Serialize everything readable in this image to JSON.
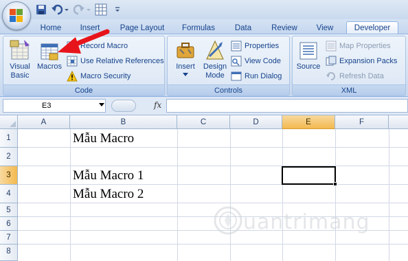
{
  "quick_access": {
    "icons": [
      "office-button",
      "save-icon",
      "undo-icon",
      "redo-icon",
      "form-icon",
      "customize-icon"
    ]
  },
  "tabs": [
    {
      "label": "Home",
      "active": false
    },
    {
      "label": "Insert",
      "active": false
    },
    {
      "label": "Page Layout",
      "active": false
    },
    {
      "label": "Formulas",
      "active": false
    },
    {
      "label": "Data",
      "active": false
    },
    {
      "label": "Review",
      "active": false
    },
    {
      "label": "View",
      "active": false
    },
    {
      "label": "Developer",
      "active": true
    }
  ],
  "ribbon": {
    "code": {
      "label": "Code",
      "visual_basic": "Visual Basic",
      "macros": "Macros",
      "record_macro": "Record Macro",
      "use_relative": "Use Relative References",
      "macro_security": "Macro Security"
    },
    "controls": {
      "label": "Controls",
      "insert": "Insert",
      "design_mode": "Design Mode",
      "properties": "Properties",
      "view_code": "View Code",
      "run_dialog": "Run Dialog"
    },
    "xml": {
      "label": "XML",
      "source": "Source",
      "map_properties": "Map Properties",
      "expansion_packs": "Expansion Packs",
      "refresh_data": "Refresh Data"
    }
  },
  "formula_bar": {
    "name_box": "E3",
    "fx": "fx",
    "formula": ""
  },
  "grid": {
    "columns": [
      "A",
      "B",
      "C",
      "D",
      "E",
      "F"
    ],
    "selected_column": "E",
    "rows": [
      "1",
      "2",
      "3",
      "4",
      "5",
      "6",
      "7",
      "8"
    ],
    "selected_row": "3",
    "cells": {
      "B1": "Mẫu Macro",
      "B3": "Mẫu Macro 1",
      "B4": "Mẫu Macro 2"
    },
    "active_cell": "E3"
  },
  "colors": {
    "ribbon_text": "#15428b",
    "selected_header": "#f2b94f",
    "annotation_arrow": "#e8141b"
  },
  "watermark": "uantrimang"
}
